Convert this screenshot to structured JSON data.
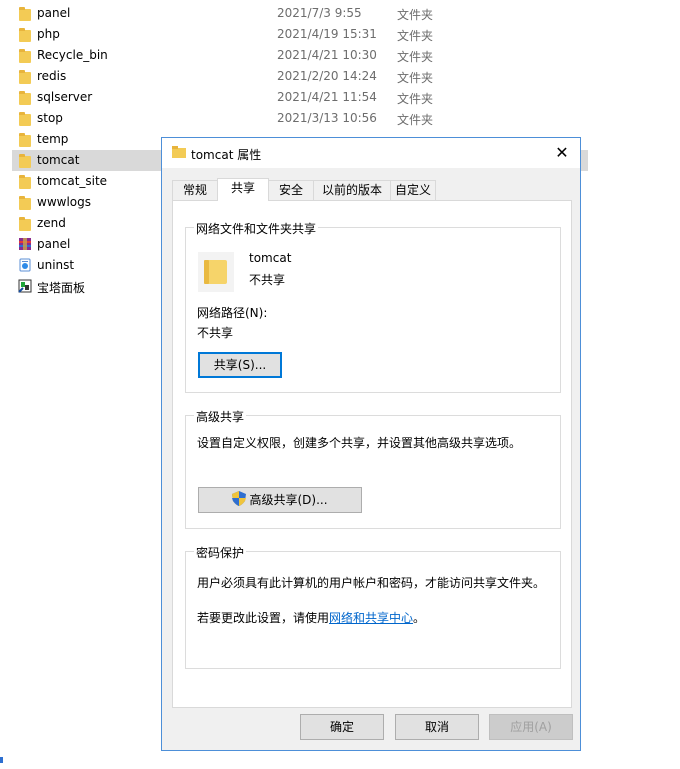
{
  "files": [
    {
      "name": "panel",
      "date": "2021/7/3 9:55",
      "type": "文件夹",
      "icon": "folder-icon",
      "selected": false
    },
    {
      "name": "php",
      "date": "2021/4/19 15:31",
      "type": "文件夹",
      "icon": "folder-icon",
      "selected": false
    },
    {
      "name": "Recycle_bin",
      "date": "2021/4/21 10:30",
      "type": "文件夹",
      "icon": "folder-icon",
      "selected": false
    },
    {
      "name": "redis",
      "date": "2021/2/20 14:24",
      "type": "文件夹",
      "icon": "folder-icon",
      "selected": false
    },
    {
      "name": "sqlserver",
      "date": "2021/4/21 11:54",
      "type": "文件夹",
      "icon": "folder-icon",
      "selected": false
    },
    {
      "name": "stop",
      "date": "2021/3/13 10:56",
      "type": "文件夹",
      "icon": "folder-icon",
      "selected": false
    },
    {
      "name": "temp",
      "date": "",
      "type": "",
      "icon": "folder-icon",
      "selected": false
    },
    {
      "name": "tomcat",
      "date": "",
      "type": "",
      "icon": "folder-icon",
      "selected": true
    },
    {
      "name": "tomcat_site",
      "date": "",
      "type": "",
      "icon": "folder-icon",
      "selected": false
    },
    {
      "name": "wwwlogs",
      "date": "",
      "type": "",
      "icon": "folder-icon",
      "selected": false
    },
    {
      "name": "zend",
      "date": "",
      "type": "",
      "icon": "folder-icon",
      "selected": false
    },
    {
      "name": "panel",
      "date": "",
      "type": "",
      "icon": "winrar-icon",
      "selected": false
    },
    {
      "name": "uninst",
      "date": "",
      "type": "",
      "icon": "uninstall-icon",
      "selected": false
    },
    {
      "name": "宝塔面板",
      "date": "",
      "type": "",
      "icon": "bt-panel-icon",
      "selected": false
    }
  ],
  "dialog": {
    "title": "tomcat 属性",
    "close_glyph": "✕",
    "tabs": [
      {
        "label": "常规",
        "active": false
      },
      {
        "label": "共享",
        "active": true
      },
      {
        "label": "安全",
        "active": false
      },
      {
        "label": "以前的版本",
        "active": false
      },
      {
        "label": "自定义",
        "active": false
      }
    ],
    "sharing": {
      "group_title": "网络文件和文件夹共享",
      "folder_name": "tomcat",
      "folder_status": "不共享",
      "network_path_label": "网络路径(N):",
      "network_path_value": "不共享",
      "share_button": "共享(S)..."
    },
    "advanced": {
      "group_title": "高级共享",
      "description": "设置自定义权限，创建多个共享，并设置其他高级共享选项。",
      "button": "高级共享(D)..."
    },
    "password": {
      "group_title": "密码保护",
      "description": "用户必须具有此计算机的用户帐户和密码，才能访问共享文件夹。",
      "change_prefix": "若要更改此设置，请使用",
      "change_link": "网络和共享中心",
      "change_suffix": "。"
    },
    "buttons": {
      "ok": "确定",
      "cancel": "取消",
      "apply": "应用(A)"
    }
  },
  "colors": {
    "accent": "#0078d7",
    "folder": "#f3cb55",
    "selection": "#d9d9d9",
    "link": "#0066cc"
  }
}
